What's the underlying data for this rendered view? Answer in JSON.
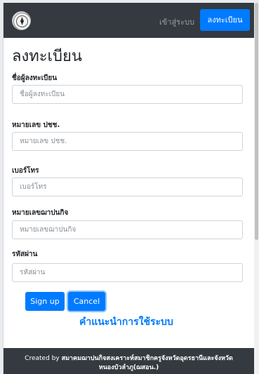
{
  "navbar": {
    "logo_icon": "seal-emblem-icon",
    "login_link": "เข้าสู่ระบบ",
    "register_button": "ลงทะเบียน"
  },
  "page": {
    "title": "ลงทะเบียน"
  },
  "form": {
    "fields": [
      {
        "label": "ชื่อผู้ลงทะเบียน",
        "placeholder": "ชื่อผู้ลงทะเบียน",
        "value": ""
      },
      {
        "label": "หมายเลข ปชช.",
        "placeholder": "หมายเลข ปชช.",
        "value": ""
      },
      {
        "label": "เบอร์โทร",
        "placeholder": "เบอร์โทร",
        "value": ""
      },
      {
        "label": "หมายเลขฌาปนกิจ",
        "placeholder": "หมายเลขฌาปนกิจ",
        "value": ""
      },
      {
        "label": "รหัสผ่าน",
        "placeholder": "รหัสผ่าน",
        "value": ""
      }
    ],
    "signup_button": "Sign up",
    "cancel_button": "Cancel",
    "help_link": "คำแนะนำการใช้ระบบ"
  },
  "footer": {
    "prefix": "Created by",
    "org_line1": "สมาคมฌาปนกิจสงเคราะห์สมาชิกครูจังหวัดอุดรธานีและจังหวัด",
    "org_line2": "หนองบัวลำภู(ฌสอน.)"
  },
  "colors": {
    "navbar": "#343a40",
    "primary": "#007bff",
    "footer": "#343a40"
  }
}
